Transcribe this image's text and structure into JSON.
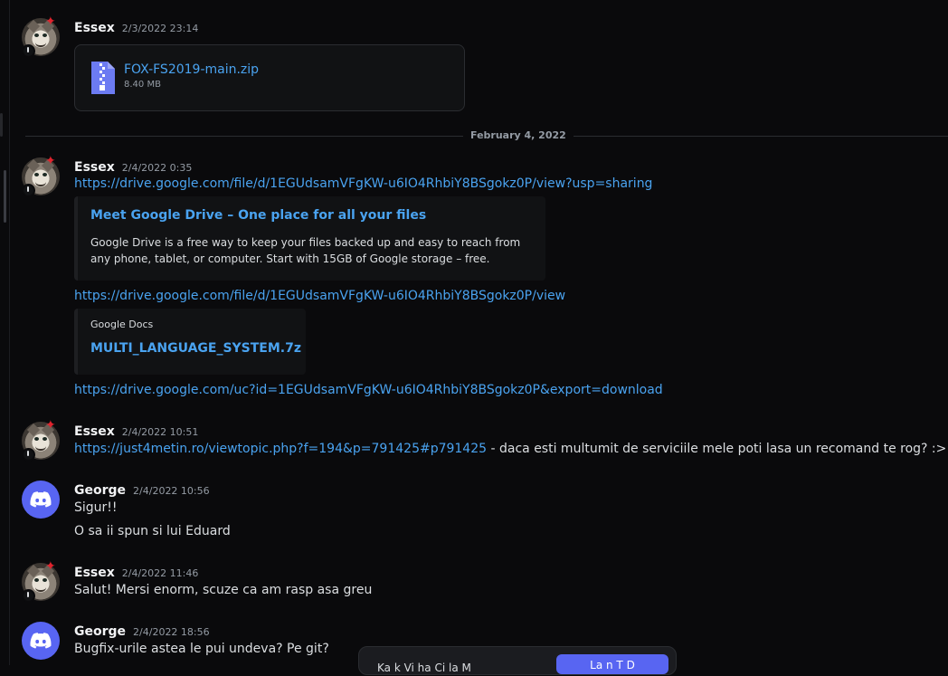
{
  "messages": [
    {
      "author": "Essex",
      "time": "2/3/2022 23:14"
    },
    {
      "author": "Essex",
      "time": "2/4/2022 0:35"
    },
    {
      "author": "Essex",
      "time": "2/4/2022 10:51"
    },
    {
      "author": "George",
      "time": "2/4/2022 10:56"
    },
    {
      "author": "Essex",
      "time": "2/4/2022 11:46"
    },
    {
      "author": "George",
      "time": "2/4/2022 18:56"
    }
  ],
  "attachment": {
    "filename": "FOX-FS2019-main.zip",
    "size": "8.40 MB"
  },
  "divider": {
    "date": "February 4, 2022"
  },
  "links": {
    "drive_sharing": "https://drive.google.com/file/d/1EGUdsamVFgKW-u6IO4RhbiY8BSgokz0P/view?usp=sharing",
    "drive_view": "https://drive.google.com/file/d/1EGUdsamVFgKW-u6IO4RhbiY8BSgokz0P/view",
    "drive_download": "https://drive.google.com/uc?id=1EGUdsamVFgKW-u6IO4RhbiY8BSgokz0P&export=download",
    "forum": "https://just4metin.ro/viewtopic.php?f=194&p=791425#p791425"
  },
  "embeds": {
    "drive": {
      "title": "Meet Google Drive – One place for all your files",
      "description": "Google Drive is a free way to keep your files backed up and easy to reach from any phone, tablet, or computer. Start with 15GB of Google storage – free."
    },
    "docs": {
      "provider": "Google Docs",
      "title": "MULTI_LANGUAGE_SYSTEM.7z"
    }
  },
  "texts": {
    "forum_suffix": " - daca esti multumit de serviciile mele poti lasa un recomand te rog? :>",
    "george1_line1": "Sigur!!",
    "george1_line2": "O sa ii spun si lui Eduard",
    "essex_thanks": "Salut! Mersi enorm, scuze ca am rasp asa greu",
    "george2_line1": "Bugfix-urile astea le pui undeva? Pe git?"
  },
  "popup": {
    "text": "Ka  k  Vi  ha  Ci  la  M",
    "button": "La  n  T  D"
  },
  "colors": {
    "background": "#0a0a0c",
    "link": "#4aa3f0",
    "brand": "#5865f2"
  },
  "icons": {
    "file": "zip-file-icon",
    "discord": "discord-logo-icon",
    "badge": "clock-status-icon"
  }
}
